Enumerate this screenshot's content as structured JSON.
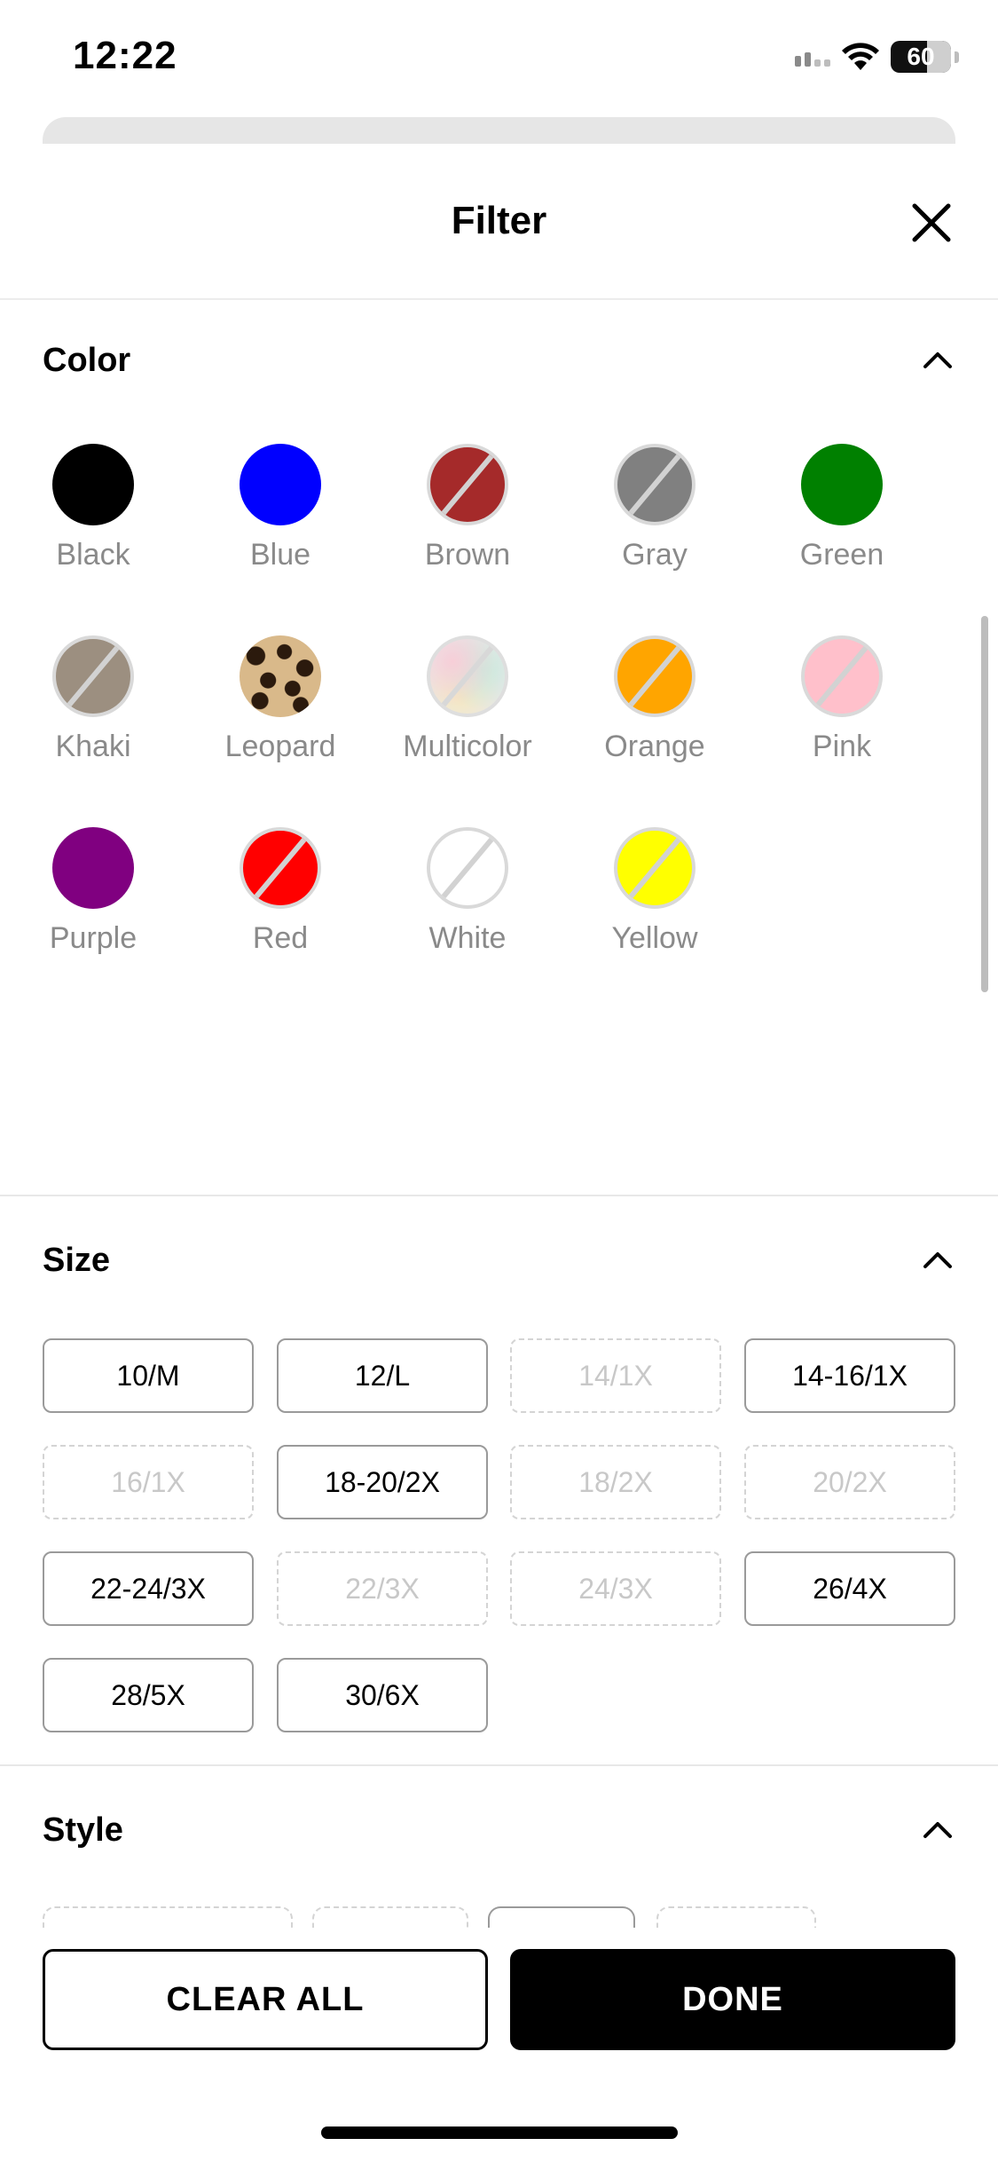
{
  "status_bar": {
    "time": "12:22",
    "battery": "60"
  },
  "header": {
    "title": "Filter"
  },
  "color_section": {
    "title": "Color",
    "items": [
      {
        "label": "Black",
        "color": "#000000",
        "available": true
      },
      {
        "label": "Blue",
        "color": "#0000ff",
        "available": true
      },
      {
        "label": "Brown",
        "color": "#a52a2a",
        "available": false
      },
      {
        "label": "Gray",
        "color": "#808080",
        "available": false
      },
      {
        "label": "Green",
        "color": "#008000",
        "available": true
      },
      {
        "label": "Khaki",
        "color": "#9c8f80",
        "available": false
      },
      {
        "label": "Leopard",
        "color": "pattern-leopard",
        "available": true
      },
      {
        "label": "Multicolor",
        "color": "pattern-multicolor",
        "available": false
      },
      {
        "label": "Orange",
        "color": "#ffa500",
        "available": false
      },
      {
        "label": "Pink",
        "color": "#ffc0cb",
        "available": false
      },
      {
        "label": "Purple",
        "color": "#800080",
        "available": true
      },
      {
        "label": "Red",
        "color": "#ff0000",
        "available": false
      },
      {
        "label": "White",
        "color": "#ffffff",
        "available": false
      },
      {
        "label": "Yellow",
        "color": "#ffff00",
        "available": false
      }
    ]
  },
  "size_section": {
    "title": "Size",
    "items": [
      {
        "label": "10/M",
        "available": true
      },
      {
        "label": "12/L",
        "available": true
      },
      {
        "label": "14/1X",
        "available": false
      },
      {
        "label": "14-16/1X",
        "available": true
      },
      {
        "label": "16/1X",
        "available": false
      },
      {
        "label": "18-20/2X",
        "available": true
      },
      {
        "label": "18/2X",
        "available": false
      },
      {
        "label": "20/2X",
        "available": false
      },
      {
        "label": "22-24/3X",
        "available": true
      },
      {
        "label": "22/3X",
        "available": false
      },
      {
        "label": "24/3X",
        "available": false
      },
      {
        "label": "26/4X",
        "available": true
      },
      {
        "label": "28/5X",
        "available": true
      },
      {
        "label": "30/6X",
        "available": true
      }
    ]
  },
  "style_section": {
    "title": "Style"
  },
  "actions": {
    "clear_all": "CLEAR ALL",
    "done": "DONE"
  }
}
